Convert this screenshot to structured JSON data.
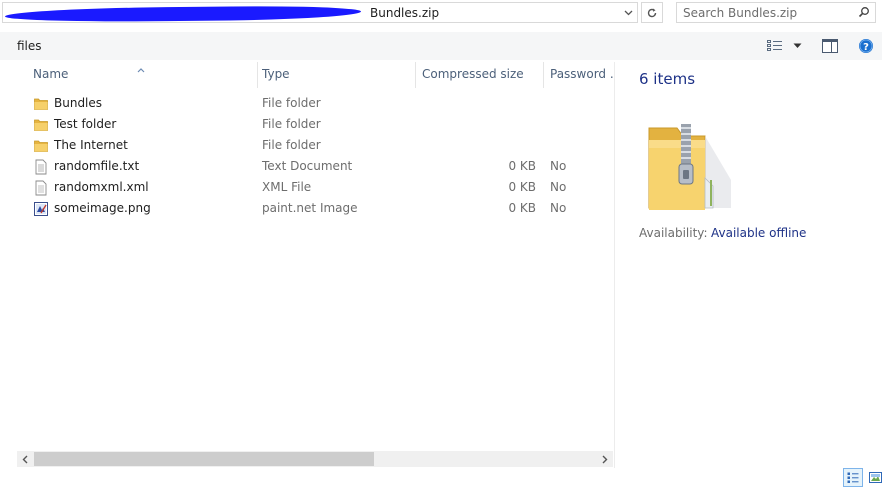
{
  "address": {
    "path": "Bundles.zip"
  },
  "search": {
    "placeholder": "Search Bundles.zip"
  },
  "toolbar": {
    "label": "files"
  },
  "columns": {
    "name": "Name",
    "type": "Type",
    "compressed_size": "Compressed size",
    "password": "Password ..."
  },
  "files": [
    {
      "name": "Bundles",
      "type": "File folder",
      "size": "",
      "password": "",
      "icon": "folder-icon"
    },
    {
      "name": "Test folder",
      "type": "File folder",
      "size": "",
      "password": "",
      "icon": "folder-icon"
    },
    {
      "name": "The Internet",
      "type": "File folder",
      "size": "",
      "password": "",
      "icon": "folder-icon"
    },
    {
      "name": "randomfile.txt",
      "type": "Text Document",
      "size": "0 KB",
      "password": "No",
      "icon": "text-file-icon"
    },
    {
      "name": "randomxml.xml",
      "type": "XML File",
      "size": "0 KB",
      "password": "No",
      "icon": "xml-file-icon"
    },
    {
      "name": "someimage.png",
      "type": "paint.net Image",
      "size": "0 KB",
      "password": "No",
      "icon": "image-file-icon"
    }
  ],
  "details": {
    "item_count": "6 items",
    "availability_label": "Availability:",
    "availability_value": "Available offline"
  },
  "colors": {
    "accent_text": "#1e3287",
    "header_text": "#4c607a",
    "folder_yellow": "#f4c85a",
    "selected_view_bg": "#e5f3fb"
  }
}
